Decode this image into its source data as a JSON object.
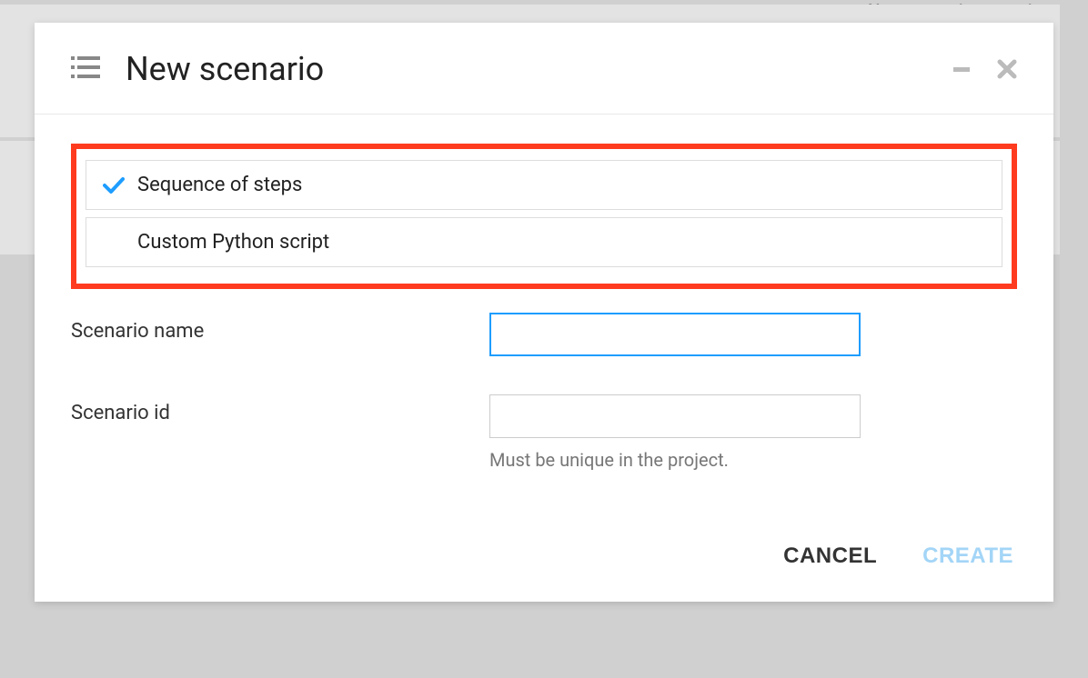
{
  "background": {
    "partial_text": "No automatic execution"
  },
  "modal": {
    "title": "New scenario",
    "options": [
      {
        "label": "Sequence of steps",
        "selected": true
      },
      {
        "label": "Custom Python script",
        "selected": false
      }
    ],
    "fields": {
      "name": {
        "label": "Scenario name",
        "value": ""
      },
      "id": {
        "label": "Scenario id",
        "value": "",
        "helper": "Must be unique in the project."
      }
    },
    "footer": {
      "cancel": "CANCEL",
      "create": "CREATE"
    }
  }
}
